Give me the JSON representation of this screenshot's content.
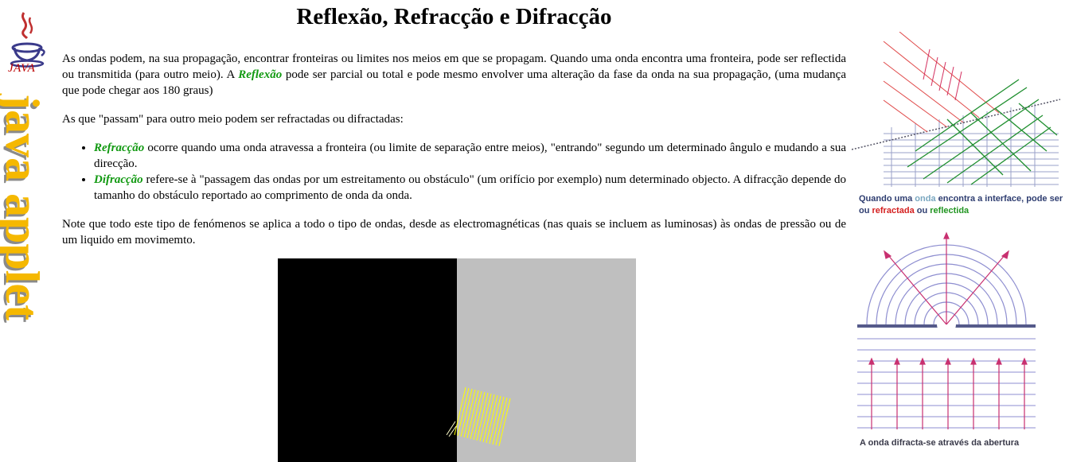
{
  "sidebar": {
    "logo_text": "JAVA",
    "vertical_label": "java applet"
  },
  "page": {
    "title": "Reflexão, Refracção e Difracção",
    "p1_a": "As ondas podem, na sua propagação, encontrar fronteiras ou limites nos meios em que se propagam. Quando uma onda encontra uma fronteira, pode ser reflectida ou transmitida (para outro meio). A ",
    "p1_term": "Reflexão",
    "p1_b": " pode ser parcial ou total e pode mesmo envolver uma alteração da fase da onda na sua propagação, (uma mudança que pode chegar aos 180 graus)",
    "p2": "As que \"passam\" para outro meio podem ser refractadas ou difractadas:",
    "list": [
      {
        "term": "Refracção",
        "text": " ocorre quando uma onda atravessa a fronteira (ou limite de separação entre meios), \"entrando\" segundo um determinado ângulo e mudando a sua direcção."
      },
      {
        "term": "Difracção",
        "text": " refere-se à \"passagem das ondas por um estreitamento ou obstáculo\" (um orifício por exemplo) num determinado objecto. A difracção depende do tamanho do obstáculo reportado ao comprimento de onda da onda."
      }
    ],
    "p3": "Note que todo este tipo de fenómenos se aplica a todo o tipo de ondas, desde as electromagnéticas (nas quais se incluem as luminosas) às ondas de pressão ou de um liquido em movimemto."
  },
  "figures": {
    "caption1": {
      "a": "Quando uma ",
      "onda": "onda",
      "b": " encontra a interface, pode ser ou ",
      "refractada": "refractada",
      "c": " ou ",
      "reflectida": "reflectida"
    },
    "caption2": "A onda difracta-se através da abertura"
  },
  "colors": {
    "accent_term": "#119911",
    "refract": "#d42020",
    "reflect": "#219521"
  }
}
